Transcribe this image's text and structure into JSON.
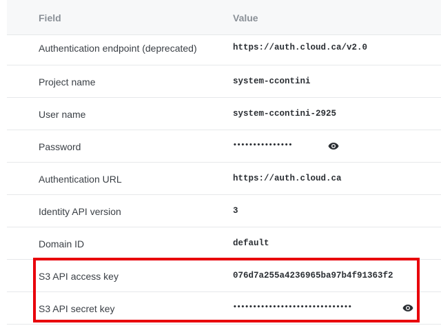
{
  "header": {
    "field_label": "Field",
    "value_label": "Value"
  },
  "rows": [
    {
      "field": "Authentication endpoint (deprecated)",
      "value": "https://auth.cloud.ca/v2.0"
    },
    {
      "field": "Project name",
      "value": "system-ccontini"
    },
    {
      "field": "User name",
      "value": "system-ccontini-2925"
    },
    {
      "field": "Password",
      "value": "•••••••••••••••",
      "masked": true,
      "icon": "eye-icon"
    },
    {
      "field": "Authentication URL",
      "value": "https://auth.cloud.ca"
    },
    {
      "field": "Identity API version",
      "value": "3"
    },
    {
      "field": "Domain ID",
      "value": "default"
    },
    {
      "field": "S3 API access key",
      "value": "076d7a255a4236965ba97b4f91363f2"
    },
    {
      "field": "S3 API secret key",
      "value": "••••••••••••••••••••••••••••••",
      "masked": true,
      "icon": "eye-icon"
    }
  ],
  "colors": {
    "highlight": "#e8000b",
    "header_bg": "#f7f8f9",
    "row_border": "#e6e8ea"
  }
}
